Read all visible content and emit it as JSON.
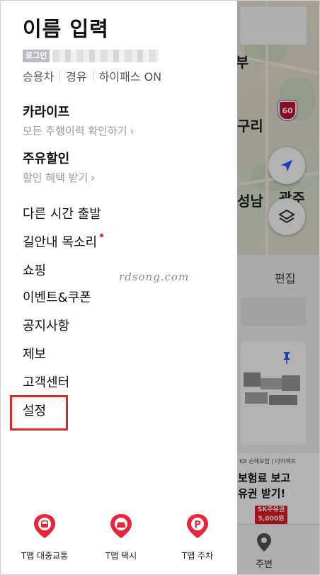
{
  "drawer": {
    "name_title": "이름 입력",
    "login_badge": "로그인",
    "car_info": [
      "승용차",
      "경유",
      "하이패스 ON"
    ],
    "kaflife": {
      "title": "카라이프",
      "sub": "모든 주행이력 확인하기"
    },
    "fuel_discount": {
      "title": "주유할인",
      "sub": "할인 혜택 받기"
    },
    "menu": [
      {
        "label": "다른 시간 출발"
      },
      {
        "label": "길안내 목소리"
      },
      {
        "label": "쇼핑"
      },
      {
        "label": "이벤트&쿠폰"
      },
      {
        "label": "공지사항"
      },
      {
        "label": "제보"
      },
      {
        "label": "고객센터"
      },
      {
        "label": "설정"
      }
    ],
    "chevron": "›",
    "shortcuts": [
      {
        "label": "T맵 대중교통",
        "icon": "bus-icon"
      },
      {
        "label": "T맵 택시",
        "icon": "taxi-icon"
      },
      {
        "label": "T맵 주차",
        "icon": "parking-icon",
        "glyph": "P"
      }
    ]
  },
  "watermark": "rdsong.com",
  "background": {
    "map_labels": [
      "부",
      "구리",
      "성남",
      "광주"
    ],
    "highway_number": "60",
    "edit_label": "편집",
    "ad_small": "KB 손해보험 | 다이렉트",
    "ad_lines": [
      "보험료 보고",
      "유권 받기!"
    ],
    "ad_coupon": [
      "SK주유권",
      "5,000원"
    ],
    "nearby_label": "주변"
  },
  "colors": {
    "accent_red": "#e8253a",
    "highlight_red": "#d42b2b",
    "badge_gray": "#b9bcc3",
    "sub_text": "#9a9a9a"
  }
}
